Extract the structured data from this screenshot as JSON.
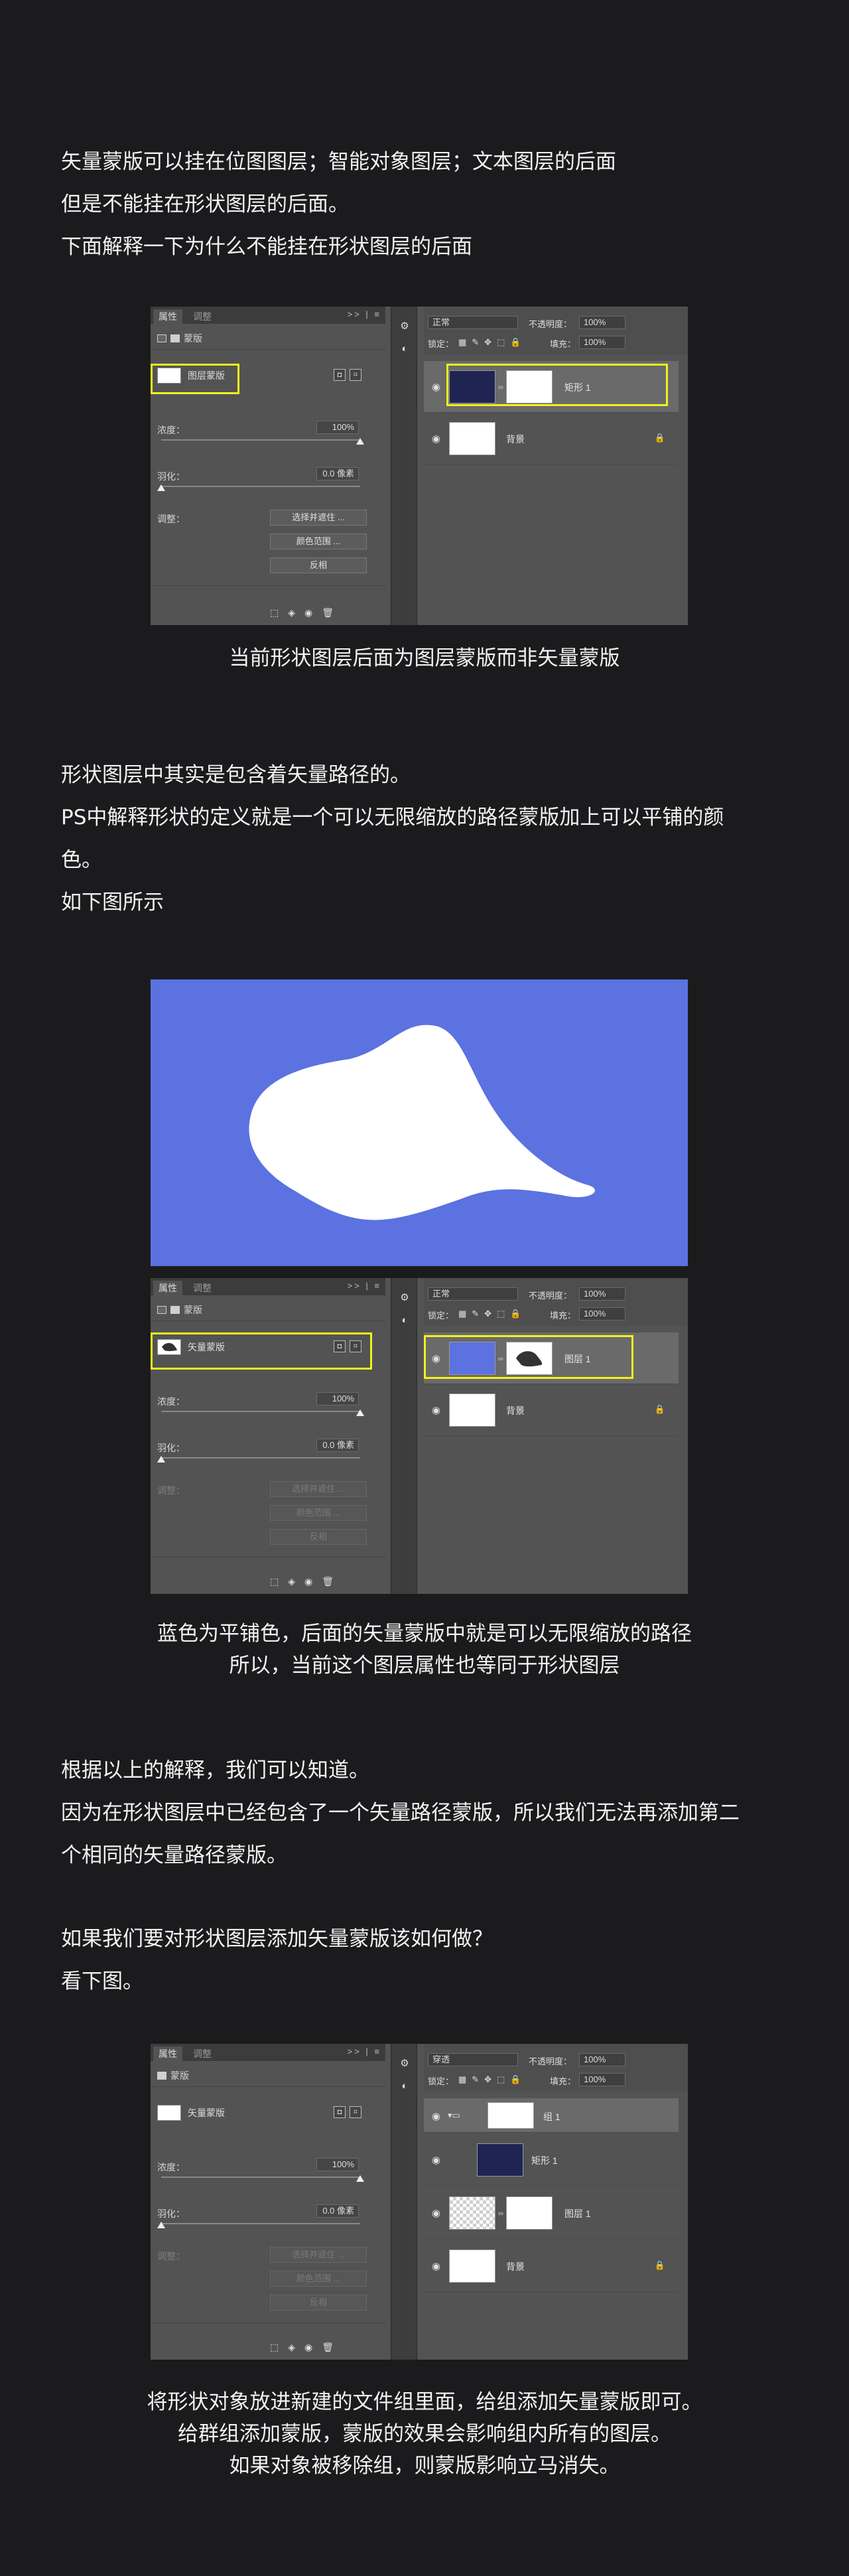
{
  "intro": {
    "lines": [
      "矢量蒙版可以挂在位图图层；智能对象图层；文本图层的后面",
      "但是不能挂在形状图层的后面。",
      "下面解释一下为什么不能挂在形状图层的后面"
    ]
  },
  "shot1": {
    "tabs": [
      "属性",
      "调整"
    ],
    "tab_right": ">> | ≡",
    "mask_type": "图层蒙版",
    "density_label": "浓度：",
    "density_value": "100%",
    "feather_label": "羽化：",
    "feather_value": "0.0 像素",
    "adjust_label": "调整：",
    "buttons": [
      "选择并遮住 ...",
      "颜色范围 ...",
      "反相"
    ],
    "blend_mode": "正常",
    "opacity_label": "不透明度：",
    "opacity_value": "100%",
    "lock_label": "锁定：",
    "fill_label": "填充：",
    "fill_value": "100%",
    "layers": [
      "矩形 1",
      "背景"
    ]
  },
  "caption1": "当前形状图层后面为图层蒙版而非矢量蒙版",
  "section2": {
    "lines": [
      "形状图层中其实是包含着矢量路径的。",
      "PS中解释形状的定义就是一个可以无限缩放的路径蒙版加上可以平铺的颜",
      "色。",
      "如下图所示"
    ]
  },
  "canvas": {
    "color": "#5b72e0",
    "shape_color": "#ffffff"
  },
  "shot2": {
    "tabs": [
      "属性",
      "调整"
    ],
    "tab_right": ">> | ≡",
    "mask_type": "矢量蒙版",
    "density_label": "浓度：",
    "density_value": "100%",
    "feather_label": "羽化：",
    "feather_value": "0.0 像素",
    "adjust_label": "调整：",
    "buttons": [
      "选择并遮住 ...",
      "颜色范围 ...",
      "反相"
    ],
    "blend_mode": "正常",
    "opacity_label": "不透明度：",
    "opacity_value": "100%",
    "lock_label": "锁定：",
    "fill_label": "填充：",
    "fill_value": "100%",
    "layers": [
      "图层 1",
      "背景"
    ]
  },
  "caption2": {
    "lines": [
      "蓝色为平铺色，后面的矢量蒙版中就是可以无限缩放的路径",
      "所以，当前这个图层属性也等同于形状图层"
    ]
  },
  "section3": {
    "lines": [
      "根据以上的解释，我们可以知道。",
      "因为在形状图层中已经包含了一个矢量路径蒙版，所以我们无法再添加第二",
      "个相同的矢量路径蒙版。"
    ]
  },
  "section4": {
    "lines": [
      "如果我们要对形状图层添加矢量蒙版该如何做？",
      "看下图。"
    ]
  },
  "shot3": {
    "tabs": [
      "属性",
      "调整"
    ],
    "tab_right": ">> | ≡",
    "mask_type": "矢量蒙版",
    "density_label": "浓度：",
    "density_value": "100%",
    "feather_label": "羽化：",
    "feather_value": "0.0 像素",
    "adjust_label": "调整：",
    "buttons": [
      "选择并遮住 ...",
      "颜色范围 ...",
      "反相"
    ],
    "blend_mode": "穿透",
    "opacity_label": "不透明度：",
    "opacity_value": "100%",
    "lock_label": "锁定：",
    "fill_label": "填充：",
    "fill_value": "100%",
    "layers": [
      "组 1",
      "矩形 1",
      "图层 1",
      "背景"
    ]
  },
  "caption3": {
    "lines": [
      "将形状对象放进新建的文件组里面，给组添加矢量蒙版即可。",
      "给群组添加蒙版，蒙版的效果会影响组内所有的图层。",
      "如果对象被移除组，则蒙版影响立马消失。"
    ]
  },
  "colors": {
    "background": "#1b1b1d",
    "highlight": "#f2f21a",
    "shape_thumb": "#1f2452",
    "blue_fill": "#5b72e0"
  }
}
